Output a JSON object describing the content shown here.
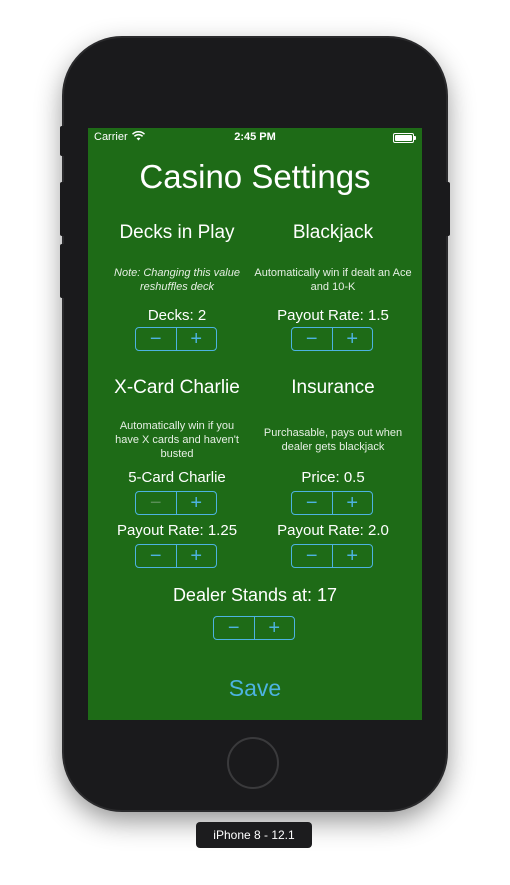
{
  "status_bar": {
    "carrier": "Carrier",
    "time": "2:45 PM",
    "icons": [
      "wifi-icon",
      "battery-icon"
    ]
  },
  "title": "Casino Settings",
  "decks": {
    "heading": "Decks in Play",
    "note": "Note: Changing this value reshuffles deck",
    "value_label": "Decks: 2"
  },
  "blackjack": {
    "heading": "Blackjack",
    "note": "Automatically win if dealt an Ace and 10-K",
    "value_label": "Payout Rate: 1.5"
  },
  "charlie": {
    "heading": "X-Card Charlie",
    "note": "Automatically win if you have X cards and haven't busted",
    "count_label": "5-Card Charlie",
    "count_minus_disabled": true,
    "payout_label": "Payout Rate: 1.25"
  },
  "insurance": {
    "heading": "Insurance",
    "note": "Purchasable, pays out when dealer gets blackjack",
    "price_label": "Price: 0.5",
    "payout_label": "Payout Rate: 2.0"
  },
  "dealer": {
    "label": "Dealer Stands at: 17"
  },
  "stepper": {
    "minus": "−",
    "plus": "+"
  },
  "save_label": "Save",
  "device_label": "iPhone 8 - 12.1",
  "colors": {
    "screen_bg": "#1e6b17",
    "accent": "#4db3e0",
    "phone_body": "#1a1a1c"
  }
}
